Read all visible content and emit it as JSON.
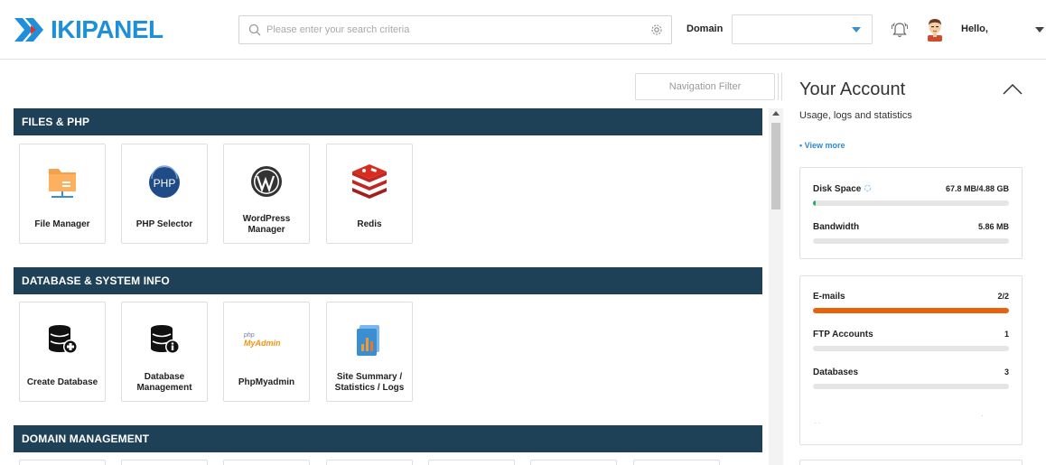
{
  "header": {
    "logo_text_prefix": "IKI",
    "logo_text_suffix": "PANEL",
    "search_placeholder": "Please enter your search criteria",
    "domain_label": "Domain",
    "domain_value": "",
    "greeting": "Hello,"
  },
  "colors": {
    "brand_blue": "#1e8fd8",
    "brand_red": "#e0332e",
    "section_bar": "#1f4157",
    "link": "#2b8ad6",
    "progress_green": "#27ae60",
    "progress_orange": "#e8620d"
  },
  "main": {
    "nav_filter_placeholder": "Navigation Filter",
    "sections": [
      {
        "title": "FILES & PHP",
        "tiles": [
          {
            "label": "File Manager",
            "icon": "folder-icon"
          },
          {
            "label": "PHP Selector",
            "icon": "php-icon"
          },
          {
            "label": "WordPress Manager",
            "icon": "wordpress-icon"
          },
          {
            "label": "Redis",
            "icon": "redis-icon"
          }
        ]
      },
      {
        "title": "DATABASE & SYSTEM INFO",
        "tiles": [
          {
            "label": "Create Database",
            "icon": "database-add-icon"
          },
          {
            "label": "Database Management",
            "icon": "database-manage-icon"
          },
          {
            "label": "PhpMyadmin",
            "icon": "phpmyadmin-icon"
          },
          {
            "label": "Site Summary / Statistics / Logs",
            "icon": "statistics-icon"
          }
        ]
      },
      {
        "title": "DOMAIN MANAGEMENT",
        "tiles": []
      }
    ],
    "phpmyadmin_logo_small": "php",
    "phpmyadmin_logo_big": "MyAdmin"
  },
  "account": {
    "title": "Your Account",
    "subtitle": "Usage, logs and statistics",
    "view_more": "• View more",
    "card1": [
      {
        "name": "Disk Space",
        "value": "67.8 MB/4.88 GB",
        "fraction": 0.014,
        "color": "#27ae60",
        "has_info": true
      },
      {
        "name": "Bandwidth",
        "value": "5.86 MB",
        "fraction": 0.0,
        "color": "#27ae60",
        "has_info": false
      }
    ],
    "card2": [
      {
        "name": "E-mails",
        "value": "2/2",
        "fraction": 1.0,
        "color": "#e8620d"
      },
      {
        "name": "FTP Accounts",
        "value": "1",
        "fraction": 0.0,
        "color": "#27ae60"
      },
      {
        "name": "Databases",
        "value": "3",
        "fraction": 0.0,
        "color": "#27ae60"
      }
    ]
  }
}
